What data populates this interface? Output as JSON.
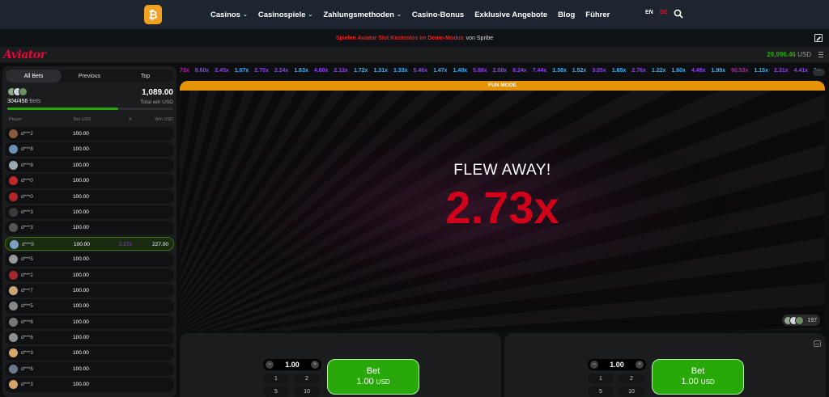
{
  "nav": {
    "logo_glyph": "₿",
    "links": [
      {
        "label": "Casinos",
        "dropdown": true
      },
      {
        "label": "Casinospiele",
        "dropdown": true
      },
      {
        "label": "Zahlungsmethoden",
        "dropdown": true
      },
      {
        "label": "Casino-Bonus",
        "dropdown": false
      },
      {
        "label": "Exklusive Angebote",
        "dropdown": false
      },
      {
        "label": "Blog",
        "dropdown": false
      },
      {
        "label": "Führer",
        "dropdown": false
      }
    ],
    "lang_en": "EN",
    "lang_de": "DE"
  },
  "promo": {
    "link_text": "Spielen Aviator Slot Kostenlos im Demo-Modus",
    "by_text": "von Spribe"
  },
  "game_header": {
    "logo": "Aviator",
    "balance": "29,996.46",
    "currency": "USD"
  },
  "bets_panel": {
    "tabs": [
      "All Bets",
      "Previous",
      "Top"
    ],
    "active_tab": "All Bets",
    "bets_count": "304/456",
    "bets_label": "Bets",
    "total_win": "1,089.00",
    "total_win_label": "Total win USD",
    "progress": 0.667,
    "columns": {
      "player": "Player",
      "bet": "Bet USD",
      "x": "X",
      "win": "Win USD"
    },
    "rows": [
      {
        "player": "d***2",
        "bet": "100.00",
        "mult": "",
        "win": "",
        "avatar_color": "#8a5a3c"
      },
      {
        "player": "d***8",
        "bet": "100.00",
        "mult": "",
        "win": "",
        "avatar_color": "#6b8fb5"
      },
      {
        "player": "d***8",
        "bet": "100.00",
        "mult": "",
        "win": "",
        "avatar_color": "#9aa7b3"
      },
      {
        "player": "d***0",
        "bet": "100.00",
        "mult": "",
        "win": "",
        "avatar_color": "#c0282c"
      },
      {
        "player": "d***0",
        "bet": "100.00",
        "mult": "",
        "win": "",
        "avatar_color": "#b32424"
      },
      {
        "player": "d***3",
        "bet": "100.00",
        "mult": "",
        "win": "",
        "avatar_color": "#3a3a3a"
      },
      {
        "player": "d***3",
        "bet": "100.00",
        "mult": "",
        "win": "",
        "avatar_color": "#555"
      },
      {
        "player": "d***9",
        "bet": "100.00",
        "mult": "2.27x",
        "win": "227.00",
        "avatar_color": "#7f9ec2",
        "won": true
      },
      {
        "player": "d***5",
        "bet": "100.00",
        "mult": "",
        "win": "",
        "avatar_color": "#999"
      },
      {
        "player": "d***2",
        "bet": "100.00",
        "mult": "",
        "win": "",
        "avatar_color": "#a0282c"
      },
      {
        "player": "d***7",
        "bet": "100.00",
        "mult": "",
        "win": "",
        "avatar_color": "#c9a57a"
      },
      {
        "player": "d***5",
        "bet": "100.00",
        "mult": "",
        "win": "",
        "avatar_color": "#888"
      },
      {
        "player": "d***6",
        "bet": "100.00",
        "mult": "",
        "win": "",
        "avatar_color": "#777"
      },
      {
        "player": "d***6",
        "bet": "100.00",
        "mult": "",
        "win": "",
        "avatar_color": "#8e8e8e"
      },
      {
        "player": "d***3",
        "bet": "100.00",
        "mult": "",
        "win": "",
        "avatar_color": "#d9a66a"
      },
      {
        "player": "d***6",
        "bet": "100.00",
        "mult": "",
        "win": "",
        "avatar_color": "#6a7a8a"
      },
      {
        "player": "d***3",
        "bet": "100.00",
        "mult": "",
        "win": "",
        "avatar_color": "#d6a46a"
      }
    ]
  },
  "history": [
    {
      "v": "73x",
      "c": "#c017b4"
    },
    {
      "v": "8.60x",
      "c": "#913ef8"
    },
    {
      "v": "2.45x",
      "c": "#913ef8"
    },
    {
      "v": "1.07x",
      "c": "#34b4ff"
    },
    {
      "v": "2.70x",
      "c": "#913ef8"
    },
    {
      "v": "2.24x",
      "c": "#913ef8"
    },
    {
      "v": "1.63x",
      "c": "#34b4ff"
    },
    {
      "v": "4.80x",
      "c": "#913ef8"
    },
    {
      "v": "2.13x",
      "c": "#913ef8"
    },
    {
      "v": "1.72x",
      "c": "#34b4ff"
    },
    {
      "v": "1.31x",
      "c": "#34b4ff"
    },
    {
      "v": "1.33x",
      "c": "#34b4ff"
    },
    {
      "v": "5.46x",
      "c": "#913ef8"
    },
    {
      "v": "1.47x",
      "c": "#34b4ff"
    },
    {
      "v": "1.40x",
      "c": "#34b4ff"
    },
    {
      "v": "5.88x",
      "c": "#913ef8"
    },
    {
      "v": "2.08x",
      "c": "#913ef8"
    },
    {
      "v": "8.24x",
      "c": "#913ef8"
    },
    {
      "v": "7.44x",
      "c": "#913ef8"
    },
    {
      "v": "1.38x",
      "c": "#34b4ff"
    },
    {
      "v": "1.52x",
      "c": "#34b4ff"
    },
    {
      "v": "3.05x",
      "c": "#913ef8"
    },
    {
      "v": "1.65x",
      "c": "#34b4ff"
    },
    {
      "v": "2.76x",
      "c": "#913ef8"
    },
    {
      "v": "1.22x",
      "c": "#34b4ff"
    },
    {
      "v": "1.60x",
      "c": "#34b4ff"
    },
    {
      "v": "4.49x",
      "c": "#913ef8"
    },
    {
      "v": "1.99x",
      "c": "#34b4ff"
    },
    {
      "v": "90.53x",
      "c": "#c017b4"
    },
    {
      "v": "1.15x",
      "c": "#34b4ff"
    },
    {
      "v": "2.31x",
      "c": "#913ef8"
    },
    {
      "v": "4.41x",
      "c": "#913ef8"
    },
    {
      "v": "1.94x",
      "c": "#34b4ff"
    }
  ],
  "history_more": "···",
  "game": {
    "mode_banner": "FUN MODE",
    "status": "FLEW AWAY!",
    "multiplier": "2.73x",
    "online_count": "197"
  },
  "bet_panels": [
    {
      "amount": "1.00",
      "quick": [
        "1",
        "2",
        "5",
        "10"
      ],
      "button_label": "Bet",
      "button_amount": "1.00",
      "button_currency": "USD"
    },
    {
      "amount": "1.00",
      "quick": [
        "1",
        "2",
        "5",
        "10"
      ],
      "button_label": "Bet",
      "button_amount": "1.00",
      "button_currency": "USD"
    }
  ],
  "colors": {
    "accent_red": "#e50539",
    "green": "#28a909",
    "fun_mode": "#e59407"
  }
}
